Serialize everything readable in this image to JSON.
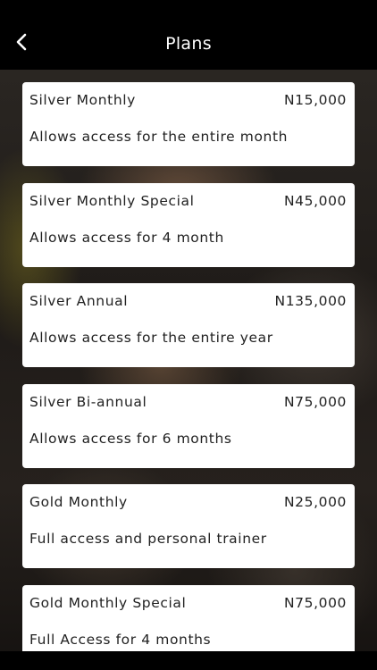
{
  "header": {
    "title": "Plans",
    "back_icon": "chevron-left-icon"
  },
  "plans": [
    {
      "name": "Silver Monthly",
      "price": "N15,000",
      "description": "Allows access for the entire month"
    },
    {
      "name": "Silver Monthly Special",
      "price": "N45,000",
      "description": "Allows access for 4 month"
    },
    {
      "name": "Silver Annual",
      "price": "N135,000",
      "description": "Allows access for the entire year"
    },
    {
      "name": "Silver Bi-annual",
      "price": "N75,000",
      "description": "Allows access for 6 months"
    },
    {
      "name": "Gold Monthly",
      "price": "N25,000",
      "description": "Full access and personal trainer"
    },
    {
      "name": "Gold Monthly Special",
      "price": "N75,000",
      "description": "Full Access for 4 months"
    }
  ],
  "colors": {
    "header_bg": "#000000",
    "card_bg": "#ffffff",
    "text": "#222222",
    "title_text": "#ffffff"
  }
}
